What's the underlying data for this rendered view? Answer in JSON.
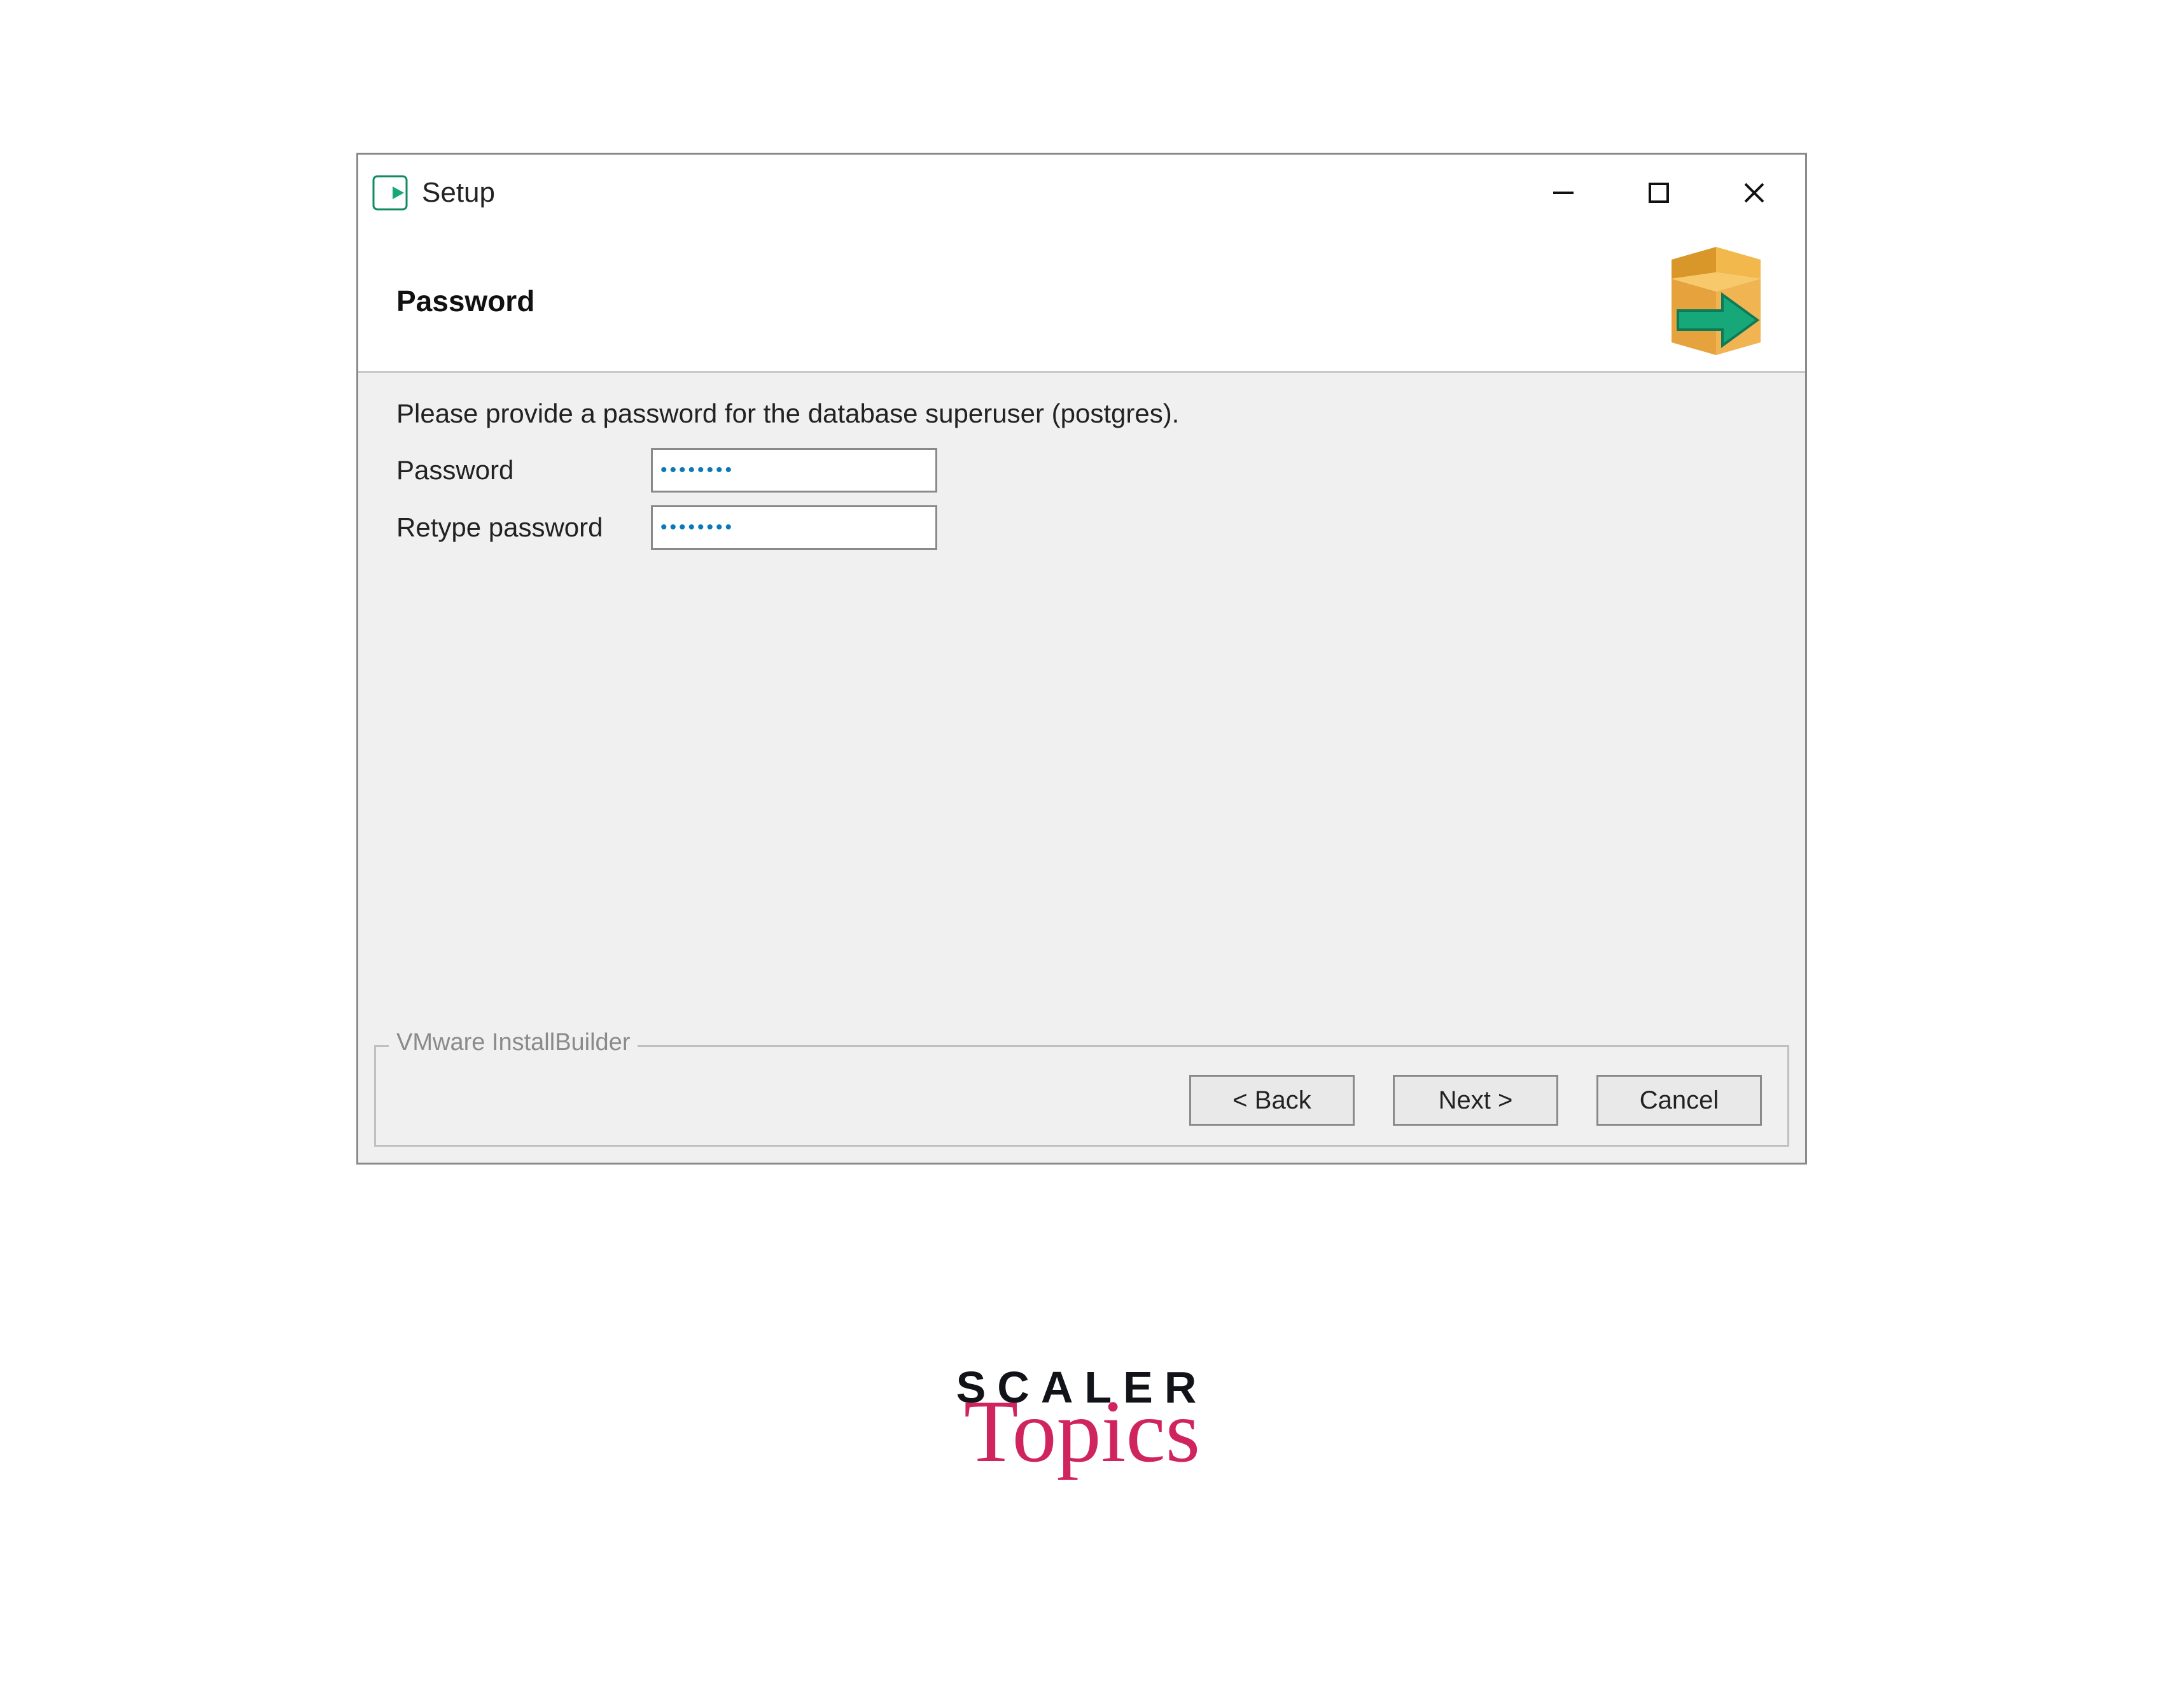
{
  "window": {
    "title": "Setup"
  },
  "header": {
    "title": "Password"
  },
  "content": {
    "instruction": "Please provide a password for the database superuser (postgres).",
    "password_label": "Password",
    "password_value": "********",
    "retype_label": "Retype password",
    "retype_value": "********"
  },
  "footer": {
    "legend": "VMware InstallBuilder",
    "back": "< Back",
    "next": "Next >",
    "cancel": "Cancel"
  },
  "branding": {
    "line1": "SCALER",
    "line2": "Topics"
  }
}
